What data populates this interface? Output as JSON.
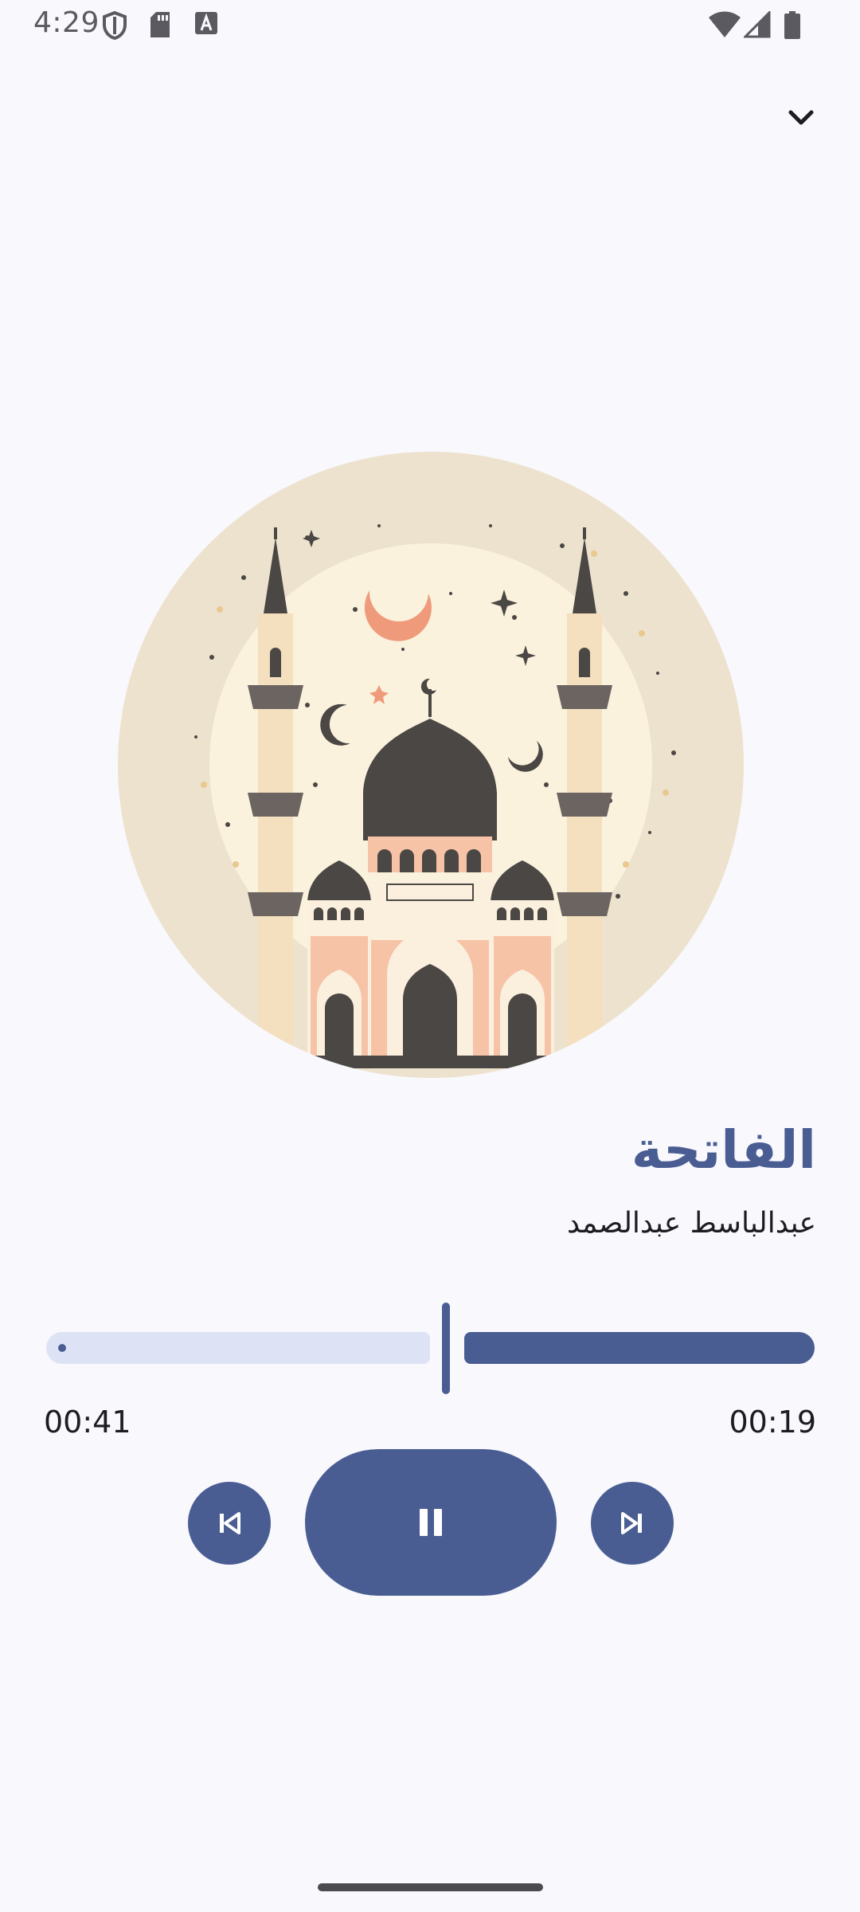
{
  "status_bar": {
    "time": "4:29",
    "icons": [
      "shield-icon",
      "sd-card-icon",
      "keyboard-a-icon",
      "wifi-icon",
      "cell-signal-icon",
      "battery-icon"
    ]
  },
  "player": {
    "collapse_icon": "chevron-down-icon",
    "title": "الفاتحة",
    "reciter": "عبدالباسط عبدالصمد",
    "elapsed": "00:41",
    "remaining": "00:19",
    "progress_fraction": 0.52,
    "controls": {
      "previous_icon": "skip-previous-icon",
      "play_pause_icon": "pause-icon",
      "next_icon": "skip-next-icon"
    }
  },
  "colors": {
    "background": "#f8f8fd",
    "accent": "#4a5d93",
    "track_light": "#dde2f5",
    "title": "#4a5d93"
  }
}
